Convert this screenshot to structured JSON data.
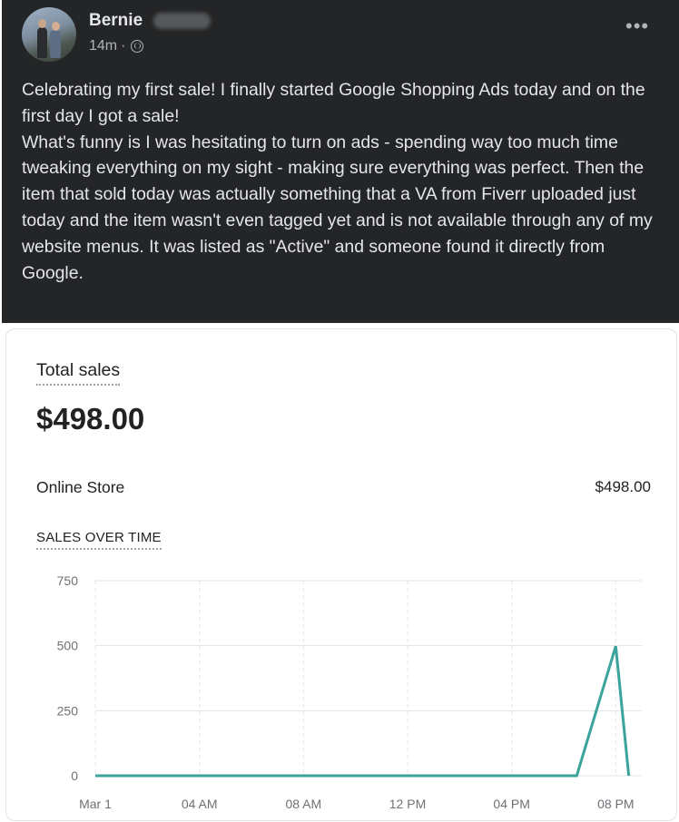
{
  "post": {
    "author": "Bernie",
    "time": "14m",
    "privacy_icon": "friends-icon",
    "more_icon": "ellipsis-icon",
    "text": "Celebrating my first sale! I finally started Google Shopping Ads today and on the first day I got a sale!\nWhat's funny is I was hesitating to turn on ads - spending way too much time tweaking everything on my sight - making sure everything was perfect. Then the item that sold today was actually something that a VA from Fiverr uploaded just today and the item wasn't even tagged yet and  is not available through any of my website menus. It was listed as \"Active\" and someone found it directly from Google."
  },
  "sales": {
    "total_label": "Total sales",
    "total_value": "$498.00",
    "channel_label": "Online Store",
    "channel_value": "$498.00",
    "chart_title": "SALES OVER TIME"
  },
  "colors": {
    "post_bg": "#242526",
    "line": "#3aa39b",
    "grid": "#e1e3e5"
  },
  "chart_data": {
    "type": "line",
    "title": "SALES OVER TIME",
    "xlabel": "",
    "ylabel": "",
    "x_ticks": [
      "Mar 1",
      "04 AM",
      "08 AM",
      "12 PM",
      "04 PM",
      "08 PM"
    ],
    "y_ticks": [
      0,
      250,
      500,
      750
    ],
    "ylim": [
      0,
      750
    ],
    "xlim_hours": [
      0,
      21
    ],
    "grid": true,
    "series": [
      {
        "x_hours": [
          0,
          18,
          18.5,
          20,
          20.5
        ],
        "values": [
          0,
          0,
          0,
          498,
          0
        ]
      }
    ]
  }
}
